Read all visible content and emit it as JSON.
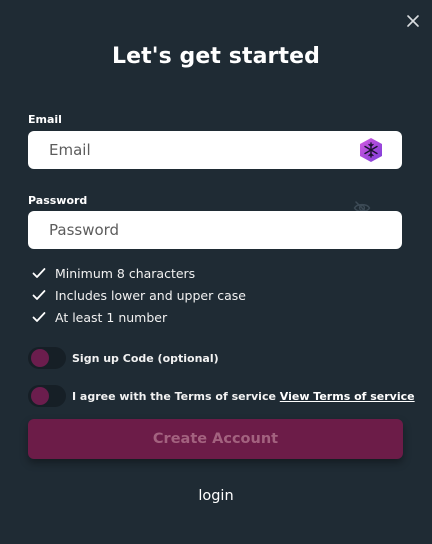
{
  "header": {
    "title": "Let's get started",
    "close_icon": "close-icon"
  },
  "email": {
    "label": "Email",
    "placeholder": "Email",
    "value": "",
    "badge_icon": "hexagon-snowflake-icon"
  },
  "password": {
    "label": "Password",
    "placeholder": "Password",
    "value": "",
    "visibility_icon": "eye-off-icon"
  },
  "rules": [
    {
      "text": "Minimum 8 characters",
      "icon": "check-icon"
    },
    {
      "text": "Includes lower and upper case",
      "icon": "check-icon"
    },
    {
      "text": "At least 1 number",
      "icon": "check-icon"
    }
  ],
  "signup_code": {
    "label": "Sign up Code (optional)",
    "enabled": false
  },
  "terms": {
    "label": "I agree with the Terms of service",
    "link": "View Terms of service",
    "enabled": false
  },
  "actions": {
    "create_label": "Create Account",
    "login_label": "login"
  },
  "colors": {
    "background": "#1f2b34",
    "accent": "#6c1c48",
    "accent_text": "#a3627f",
    "toggle_knob": "#6b1d4d",
    "badge": "#9b3fd6"
  }
}
